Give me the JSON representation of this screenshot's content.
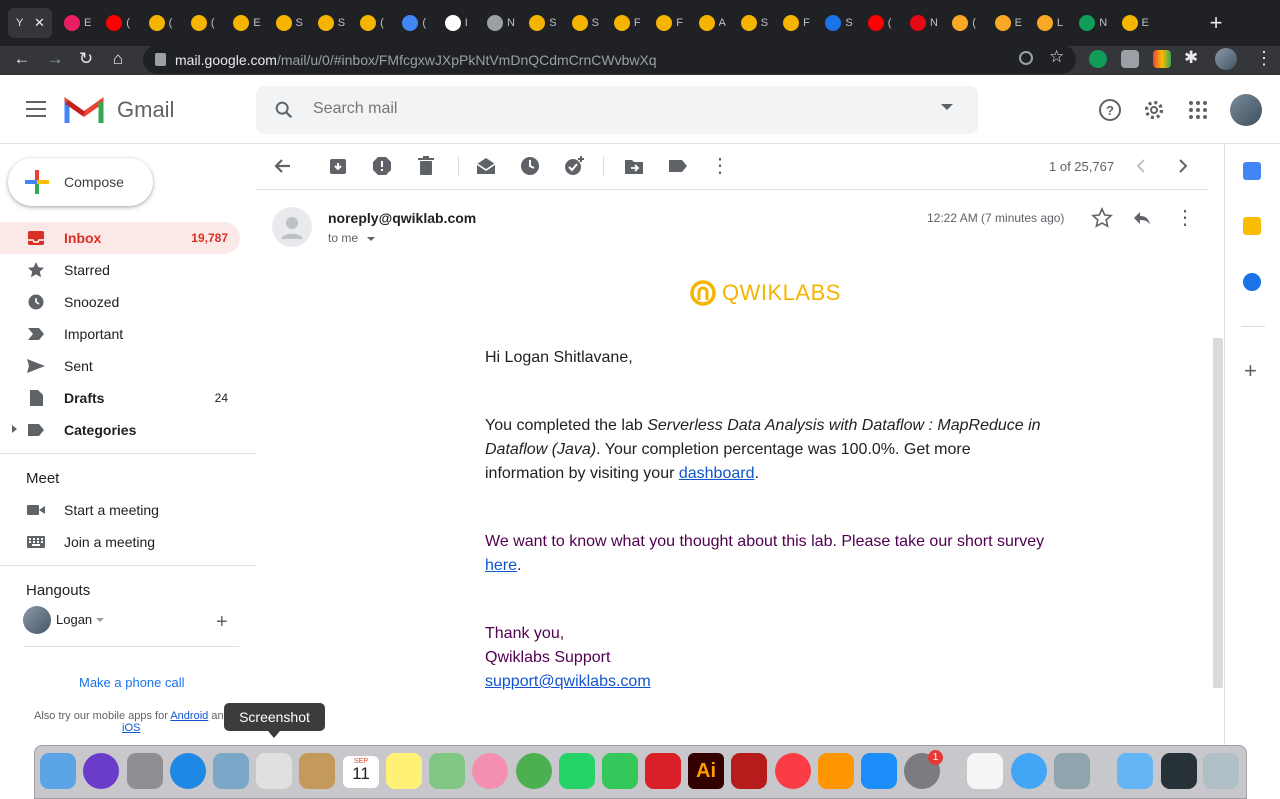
{
  "browser": {
    "active_tab_label": "Y",
    "tab_labels": [
      "E",
      "(",
      "(",
      "(",
      "E",
      "S",
      "S",
      "(",
      "(",
      "I",
      "N",
      "S",
      "S",
      "F",
      "F",
      "A",
      "S",
      "F",
      "S",
      "(",
      "N",
      "(",
      "E",
      "L",
      "N",
      "E"
    ],
    "url_host": "mail.google.com",
    "url_path": "/mail/u/0/#inbox/FMfcgxwJXpPkNtVmDnQCdmCrnCWvbwXq"
  },
  "gmail": {
    "brand": "Gmail",
    "search_placeholder": "Search mail"
  },
  "compose": {
    "label": "Compose"
  },
  "nav": [
    {
      "label": "Inbox",
      "count": "19,787",
      "icon": "inbox-icon",
      "selected": true
    },
    {
      "label": "Starred",
      "count": "",
      "icon": "star-icon"
    },
    {
      "label": "Snoozed",
      "count": "",
      "icon": "clock-icon"
    },
    {
      "label": "Important",
      "count": "",
      "icon": "important-icon"
    },
    {
      "label": "Sent",
      "count": "",
      "icon": "send-icon"
    },
    {
      "label": "Drafts",
      "count": "24",
      "icon": "draft-icon"
    },
    {
      "label": "Categories",
      "count": "",
      "icon": "label-icon"
    }
  ],
  "meet": {
    "title": "Meet",
    "start": "Start a meeting",
    "join": "Join a meeting"
  },
  "hangouts": {
    "title": "Hangouts",
    "user": "Logan",
    "phone_call": "Make a phone call",
    "mobile_prefix": "Also try our mobile apps for",
    "android": "Android",
    "and": "an",
    "ios": "iOS"
  },
  "pager": {
    "text": "1 of 25,767"
  },
  "message": {
    "sender": "noreply@qwiklab.com",
    "to": "to me",
    "time": "12:22 AM (7 minutes ago)",
    "brand": "QWIKLABS",
    "greeting": "Hi Logan Shitlavane,",
    "p1_prefix": "You completed the lab ",
    "p1_lab": "Serverless Data Analysis with Dataflow : MapReduce in Dataflow (Java)",
    "p1_suffix": ". Your completion percentage was 100.0%. Get more information by visiting your ",
    "p1_link": "dashboard",
    "p1_end": ".",
    "p2_prefix": "We want to know what you thought about this lab. Please take our short survey ",
    "p2_link": "here",
    "p2_end": ".",
    "signoff": "Thank you,",
    "team": "Qwiklabs Support",
    "support_email": "support@qwiklabs.com"
  },
  "dock": {
    "tooltip": "Screenshot",
    "calendar_day": "11",
    "calendar_month": "SEP",
    "badge": "1",
    "ai_label": "Ai"
  },
  "colors": {
    "accent_red": "#d93025",
    "link": "#1155cc",
    "purple_text": "#500050",
    "qwiklabs_yellow": "#f4b400"
  }
}
